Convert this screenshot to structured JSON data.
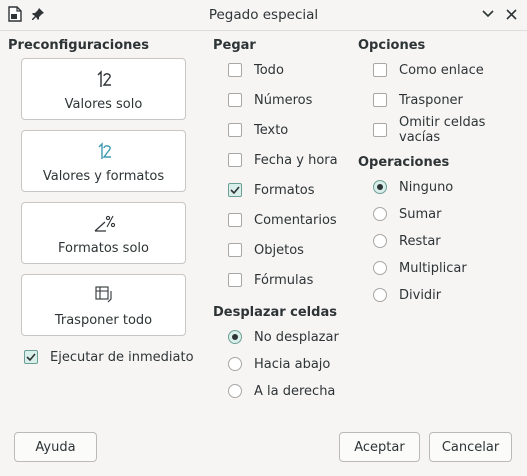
{
  "window": {
    "title": "Pegado especial",
    "app_icon": "document-icon",
    "pin_icon": "pin-icon",
    "minimize_icon": "chevron-down-icon",
    "close_icon": "close-icon"
  },
  "presets": {
    "heading": "Preconfiguraciones",
    "items": [
      {
        "label": "Valores solo",
        "icon": "values-only-icon"
      },
      {
        "label": "Valores y formatos",
        "icon": "values-formats-icon"
      },
      {
        "label": "Formatos solo",
        "icon": "formats-only-icon"
      },
      {
        "label": "Trasponer todo",
        "icon": "transpose-all-icon"
      }
    ],
    "run_now": {
      "label": "Ejecutar de inmediato",
      "checked": true
    }
  },
  "paste": {
    "heading": "Pegar",
    "items": [
      {
        "label": "Todo",
        "checked": false
      },
      {
        "label": "Números",
        "checked": false
      },
      {
        "label": "Texto",
        "checked": false
      },
      {
        "label": "Fecha y hora",
        "checked": false
      },
      {
        "label": "Formatos",
        "checked": true
      },
      {
        "label": "Comentarios",
        "checked": false
      },
      {
        "label": "Objetos",
        "checked": false
      },
      {
        "label": "Fórmulas",
        "checked": false
      }
    ]
  },
  "shift": {
    "heading": "Desplazar celdas",
    "items": [
      {
        "label": "No desplazar",
        "selected": true
      },
      {
        "label": "Hacia abajo",
        "selected": false
      },
      {
        "label": "A la derecha",
        "selected": false
      }
    ]
  },
  "options": {
    "heading": "Opciones",
    "items": [
      {
        "label": "Como enlace",
        "checked": false
      },
      {
        "label": "Trasponer",
        "checked": false
      },
      {
        "label": "Omitir celdas vacías",
        "checked": false
      }
    ]
  },
  "operations": {
    "heading": "Operaciones",
    "items": [
      {
        "label": "Ninguno",
        "selected": true
      },
      {
        "label": "Sumar",
        "selected": false
      },
      {
        "label": "Restar",
        "selected": false
      },
      {
        "label": "Multiplicar",
        "selected": false
      },
      {
        "label": "Dividir",
        "selected": false
      }
    ]
  },
  "buttons": {
    "help": "Ayuda",
    "accept": "Aceptar",
    "cancel": "Cancelar"
  },
  "colors": {
    "accent": "#6c9e95",
    "check_bg": "#d9efea",
    "icon_teal": "#3d9bb0"
  }
}
